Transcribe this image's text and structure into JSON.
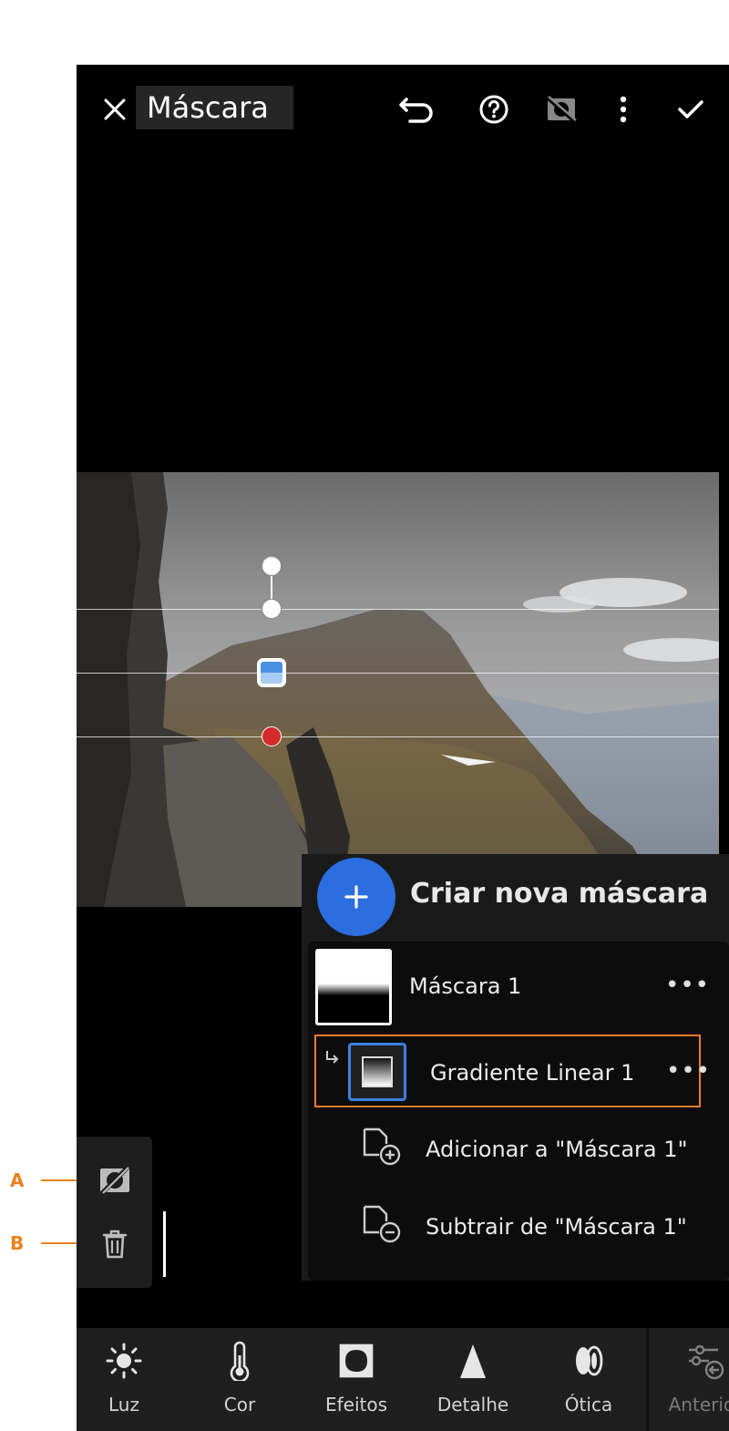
{
  "header": {
    "close_icon": "close-icon",
    "title": "Máscara",
    "undo_icon": "undo-icon",
    "help_icon": "help-icon",
    "hide_overlay_icon": "hide-overlay-icon",
    "more_icon": "more-vertical-icon",
    "confirm_icon": "checkmark-icon"
  },
  "mask_panel": {
    "create_label": "Criar nova máscara",
    "masks": [
      {
        "label": "Máscara 1",
        "more": "•••"
      },
      {
        "label": "Gradiente Linear 1",
        "more": "•••",
        "selected": true
      }
    ],
    "actions": [
      {
        "label": "Adicionar a \"Máscara 1\"",
        "icon": "add-to-mask-icon"
      },
      {
        "label": "Subtrair de \"Máscara 1\"",
        "icon": "subtract-from-mask-icon"
      }
    ]
  },
  "sidebar": {
    "hide_icon": "hide-mask-icon",
    "delete_icon": "trash-icon"
  },
  "callouts": {
    "a": "A",
    "b": "B"
  },
  "bottom_tools": [
    {
      "label": "Luz",
      "icon": "sun-icon"
    },
    {
      "label": "Cor",
      "icon": "thermometer-icon"
    },
    {
      "label": "Efeitos",
      "icon": "vignette-icon"
    },
    {
      "label": "Detalhe",
      "icon": "triangle-icon"
    },
    {
      "label": "Ótica",
      "icon": "lens-icon"
    },
    {
      "label": "Anterior",
      "icon": "previous-settings-icon"
    }
  ],
  "colors": {
    "accent_blue": "#2a6ee0",
    "selection_orange": "#ef7b2e",
    "callout_orange": "#e8821e"
  }
}
